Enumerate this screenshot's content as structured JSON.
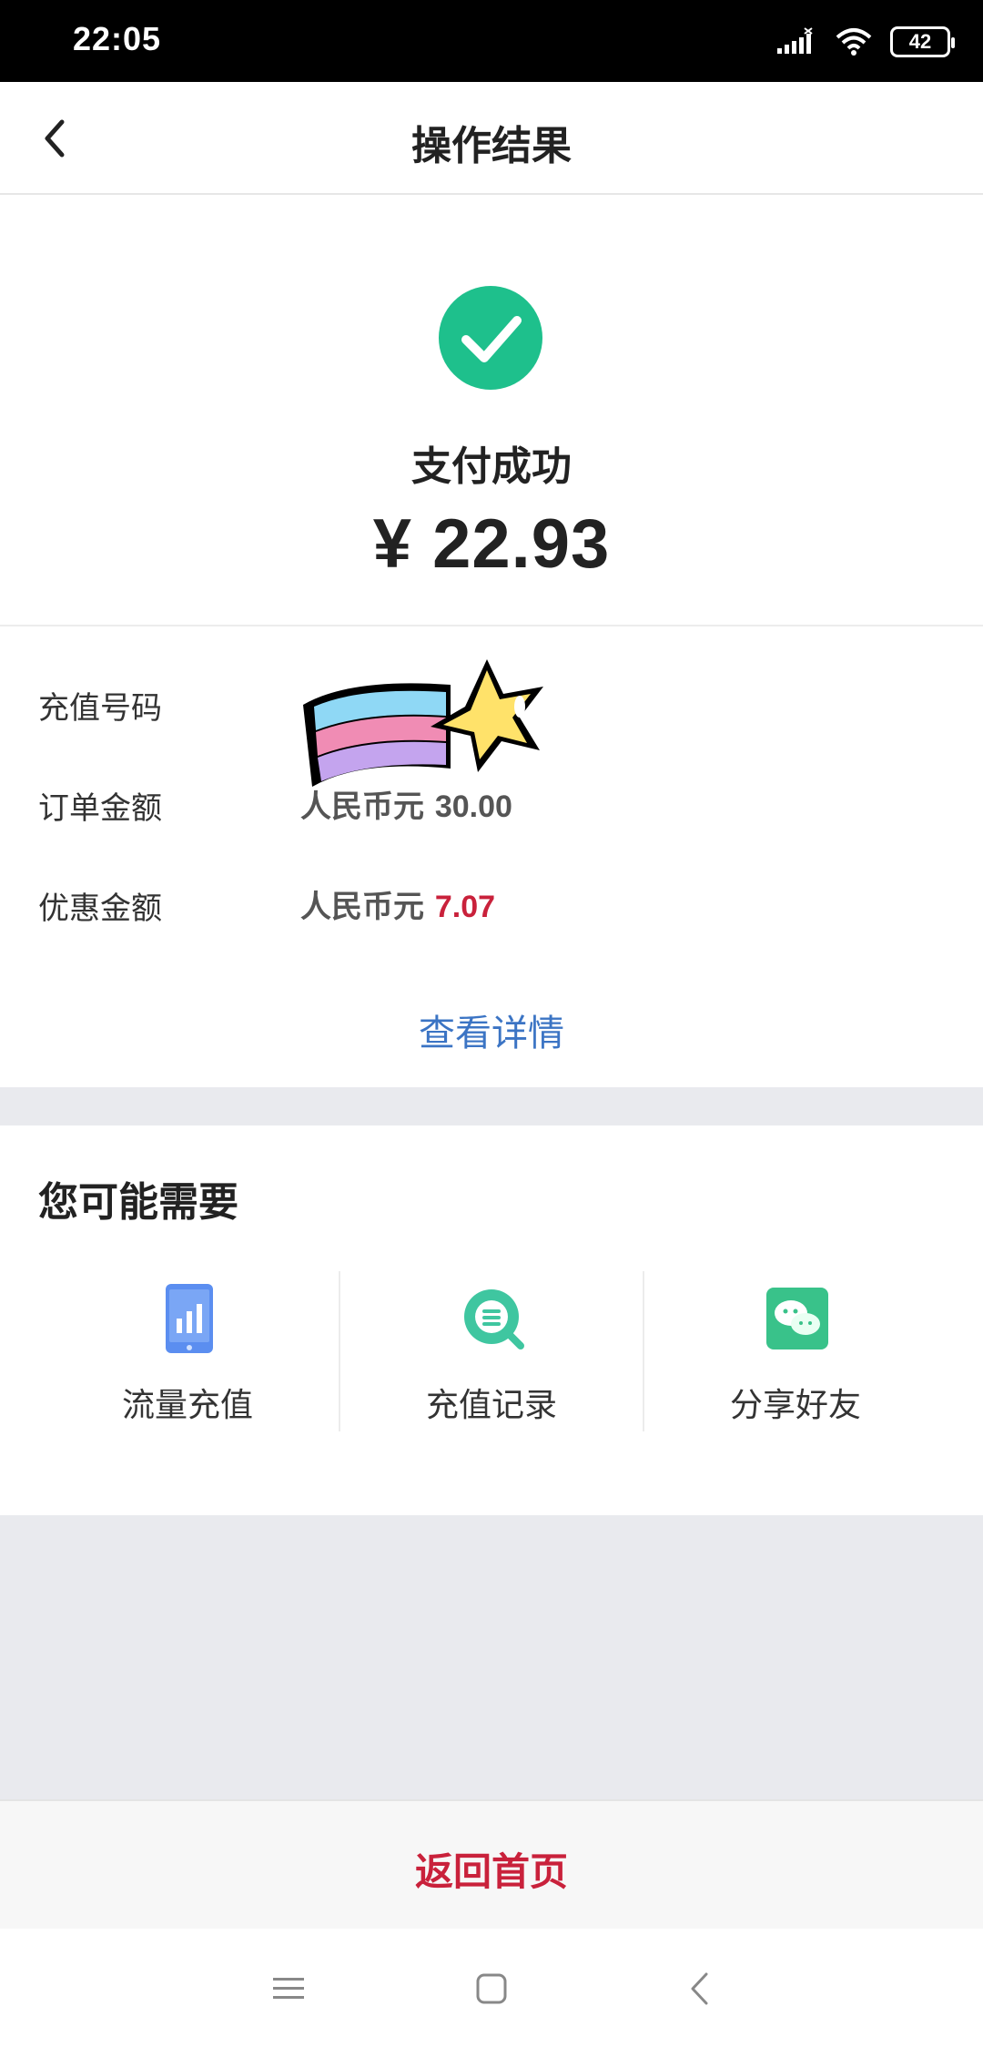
{
  "status_bar": {
    "time": "22:05",
    "battery": "42"
  },
  "navbar": {
    "title": "操作结果"
  },
  "result": {
    "title": "支付成功",
    "amount": "¥ 22.93"
  },
  "details": {
    "recharge_number_label": "充值号码",
    "order_amount_label": "订单金额",
    "order_amount_currency": "人民币元",
    "order_amount_value": "30.00",
    "discount_label": "优惠金额",
    "discount_currency": "人民币元",
    "discount_value": "7.07",
    "view_details": "查看详情"
  },
  "needs": {
    "title": "您可能需要",
    "items": [
      {
        "label": "流量充值",
        "icon": "phone-data-icon"
      },
      {
        "label": "充值记录",
        "icon": "record-search-icon"
      },
      {
        "label": "分享好友",
        "icon": "wechat-icon"
      }
    ]
  },
  "footer": {
    "home_button": "返回首页"
  },
  "colors": {
    "success": "#1ec08c",
    "accent_red": "#c9213b",
    "link_blue": "#3b74c4"
  }
}
